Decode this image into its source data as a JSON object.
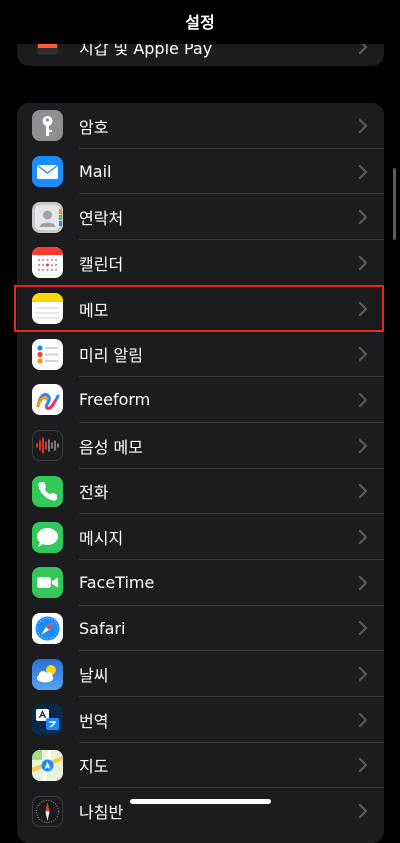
{
  "nav": {
    "title": "설정"
  },
  "top_group": {
    "items": [
      {
        "label": "지갑 및 Apple Pay",
        "icon": "wallet-icon"
      }
    ]
  },
  "list": {
    "items": [
      {
        "label": "암호",
        "icon": "key-icon",
        "color": "#8e8e93"
      },
      {
        "label": "Mail",
        "icon": "mail-icon",
        "color": "#1a8cff"
      },
      {
        "label": "연락처",
        "icon": "contacts-icon",
        "color": "#b8b8b8"
      },
      {
        "label": "캘린더",
        "icon": "calendar-icon",
        "color": "#ffffff"
      },
      {
        "label": "메모",
        "icon": "notes-icon",
        "color": "#ffd60a"
      },
      {
        "label": "미리 알림",
        "icon": "reminders-icon",
        "color": "#ffffff"
      },
      {
        "label": "Freeform",
        "icon": "freeform-icon",
        "color": "#ffffff"
      },
      {
        "label": "음성 메모",
        "icon": "voice-memos-icon",
        "color": "#1c1c1e"
      },
      {
        "label": "전화",
        "icon": "phone-icon",
        "color": "#34c759"
      },
      {
        "label": "메시지",
        "icon": "messages-icon",
        "color": "#34c759"
      },
      {
        "label": "FaceTime",
        "icon": "facetime-icon",
        "color": "#34c759"
      },
      {
        "label": "Safari",
        "icon": "safari-icon",
        "color": "#1a8cff"
      },
      {
        "label": "날씨",
        "icon": "weather-icon",
        "color": "#2f7fe0"
      },
      {
        "label": "번역",
        "icon": "translate-icon",
        "color": "#0b2a4a"
      },
      {
        "label": "지도",
        "icon": "maps-icon",
        "color": "#ffffff"
      },
      {
        "label": "나침반",
        "icon": "compass-icon",
        "color": "#1c1c1e"
      }
    ]
  },
  "selected_item": "메모",
  "colors": {
    "background": "#000000",
    "group": "#1c1c1e",
    "separator": "#38383a",
    "highlight": "#e5252a"
  }
}
